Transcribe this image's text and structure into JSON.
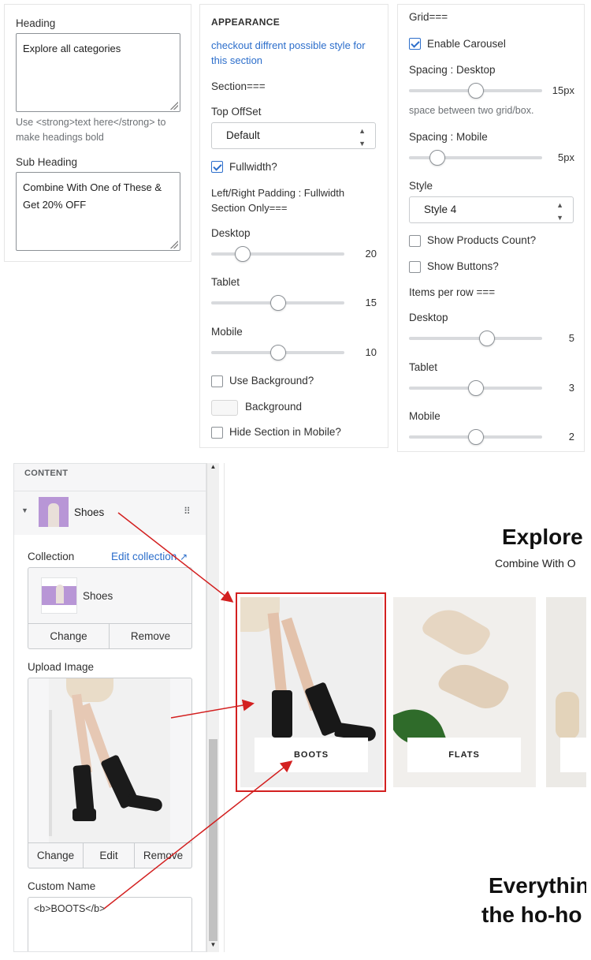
{
  "left_panel": {
    "heading_label": "Heading",
    "heading_value": "Explore all categories",
    "heading_hint": "Use <strong>text here</strong> to make headings bold",
    "subheading_label": "Sub Heading",
    "subheading_value": "Combine With One of These & Get 20% OFF"
  },
  "appearance": {
    "title": "APPEARANCE",
    "description": "checkout diffrent possible style for this section",
    "section_label": "Section===",
    "top_offset_label": "Top OffSet",
    "top_offset_value": "Default",
    "fullwidth_label": "Fullwidth?",
    "padding_label": "Left/Right Padding : Fullwidth Section Only===",
    "desktop_label": "Desktop",
    "desktop_value": "20",
    "tablet_label": "Tablet",
    "tablet_value": "15",
    "mobile_label": "Mobile",
    "mobile_value": "10",
    "use_background_label": "Use Background?",
    "background_label": "Background",
    "hide_mobile_label": "Hide Section in Mobile?"
  },
  "grid": {
    "title": "Grid===",
    "carousel_label": "Enable Carousel",
    "spacing_desktop_label": "Spacing : Desktop",
    "spacing_desktop_value": "15px",
    "spacing_hint": "space between two grid/box.",
    "spacing_mobile_label": "Spacing : Mobile",
    "spacing_mobile_value": "5px",
    "style_label": "Style",
    "style_value": "Style 4",
    "products_count_label": "Show Products Count?",
    "buttons_label": "Show Buttons?",
    "items_label": "Items per row ===",
    "desktop_label": "Desktop",
    "desktop_value": "5",
    "tablet_label": "Tablet",
    "tablet_value": "3",
    "mobile_label": "Mobile",
    "mobile_value": "2"
  },
  "editor": {
    "content_label": "CONTENT",
    "block_name": "Shoes",
    "collection_label": "Collection",
    "edit_collection": "Edit collection",
    "collection_name": "Shoes",
    "change": "Change",
    "remove": "Remove",
    "upload_label": "Upload Image",
    "edit": "Edit",
    "custom_name_label": "Custom Name",
    "custom_name_value": "<b>BOOTS</b>"
  },
  "preview": {
    "heading": "Explore",
    "subheading": "Combine With O",
    "tile1": "BOOTS",
    "tile2": "FLATS",
    "bottom_line1": "Everythin",
    "bottom_line2": "the ho-ho"
  },
  "colors": {
    "accent": "#2c6ecb",
    "annotation": "#d32020"
  }
}
